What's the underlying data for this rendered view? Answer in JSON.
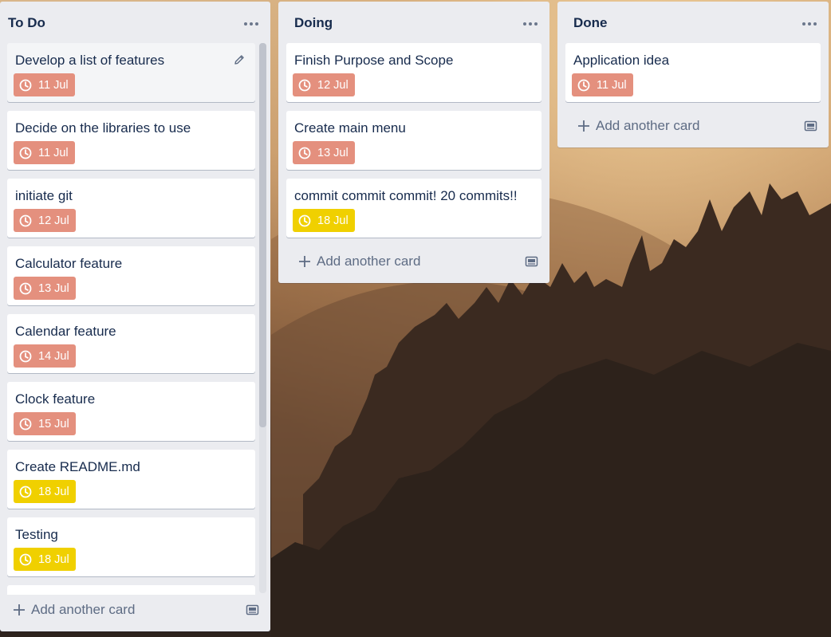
{
  "lists": [
    {
      "title": "To Do",
      "cards": [
        {
          "title": "Develop a list of features",
          "due": "11 Jul"
        },
        {
          "title": "Decide on the libraries to use",
          "due": "11 Jul"
        },
        {
          "title": "initiate git",
          "due": "12 Jul"
        },
        {
          "title": "Calculator feature",
          "due": "13 Jul"
        },
        {
          "title": "Calendar feature",
          "due": "14 Jul"
        },
        {
          "title": "Clock feature",
          "due": "15 Jul"
        },
        {
          "title": "Create README.md",
          "due": "18 Jul"
        },
        {
          "title": "Testing",
          "due": "18 Jul"
        }
      ],
      "add_label": "Add another card"
    },
    {
      "title": "Doing",
      "cards": [
        {
          "title": "Finish Purpose and Scope",
          "due": "12 Jul"
        },
        {
          "title": "Create main menu",
          "due": "13 Jul"
        },
        {
          "title": "commit commit commit! 20 commits!!",
          "due": "18 Jul"
        }
      ],
      "add_label": "Add another card"
    },
    {
      "title": "Done",
      "cards": [
        {
          "title": "Application idea",
          "due": "11 Jul"
        }
      ],
      "add_label": "Add another card"
    }
  ],
  "icons": {
    "menu": "ellipsis-icon",
    "due": "clock-icon",
    "edit": "pencil-icon",
    "add": "plus-icon",
    "template": "card-template-icon"
  },
  "colors": {
    "due_overdue": "#e4907e",
    "due_soon": "#f0d000",
    "list_bg": "#ebecf0",
    "card_text": "#172b4d",
    "muted_text": "#5e6c84"
  }
}
